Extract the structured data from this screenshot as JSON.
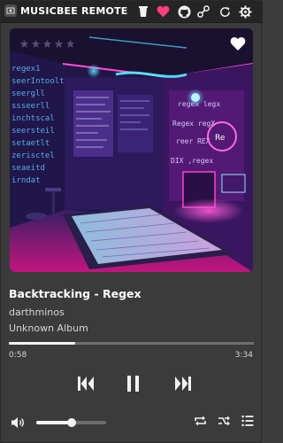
{
  "window": {
    "title": "MUSICBEE REMOTE - ..."
  },
  "titlebar": {
    "icons": [
      "app-icon",
      "cup-icon",
      "heart-icon",
      "github-icon",
      "tools-icon",
      "refresh-icon",
      "settings-icon"
    ],
    "heart_color": "#ff3d7f"
  },
  "album_art": {
    "rating_stars": 5,
    "rating_value": 0,
    "accent": "#ff2fd0"
  },
  "track": {
    "title": "Backtracking - Regex",
    "artist": "darthminos",
    "album": "Unknown Album"
  },
  "playback": {
    "elapsed": "0:58",
    "total": "3:34",
    "progress": 0.27
  },
  "controls": {
    "icons": [
      "previous-icon",
      "pause-icon",
      "next-icon",
      "volume-icon",
      "repeat-icon",
      "shuffle-icon",
      "playlist-icon"
    ]
  },
  "volume": {
    "level": 0.5
  }
}
